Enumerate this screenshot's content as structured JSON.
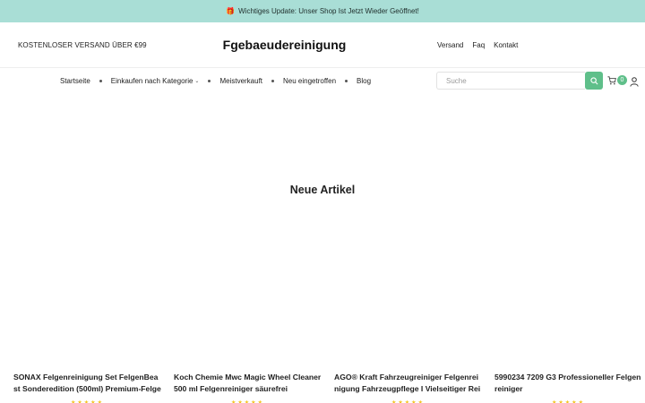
{
  "announcement": {
    "gift_icon": "gift-icon",
    "text": "Wichtiges Update: Unser Shop Ist Jetzt Wieder Geöffnet!"
  },
  "header": {
    "free_shipping": "KOSTENLOSER VERSAND ÜBER €99",
    "logo": "Fgebaeudereinigung",
    "links": [
      "Versand",
      "Faq",
      "Kontakt"
    ]
  },
  "nav": {
    "items": [
      "Startseite",
      "Einkaufen nach Kategorie",
      "Meistverkauft",
      "Neu eingetroffen",
      "Blog"
    ]
  },
  "search": {
    "placeholder": "Suche"
  },
  "cart": {
    "count": "0"
  },
  "section": {
    "title": "Neue Artikel"
  },
  "products": [
    {
      "name": "SONAX Felgenreinigung Set FelgenBeast Sonderedition (500ml) Premium-Felgenreiniger"
    },
    {
      "name": "Koch Chemie Mwc Magic Wheel Cleaner 500 ml Felgenreiniger säurefrei"
    },
    {
      "name": "AGO® Kraft Fahrzeugreiniger Felgenreinigung Fahrzeugpflege I Vielseitiger Reiniger"
    },
    {
      "name": "5990234 7209 G3 Professioneller Felgenreiniger"
    }
  ],
  "colors": {
    "announcement_bg": "#a9ded6",
    "accent": "#5fbf8a",
    "star": "#f3c31d"
  }
}
